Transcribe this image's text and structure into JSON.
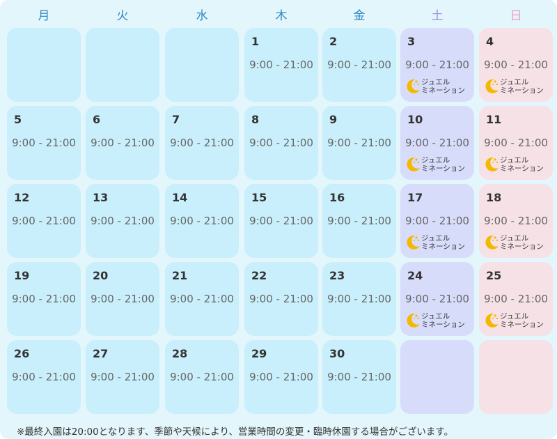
{
  "weekdays": [
    "月",
    "火",
    "水",
    "木",
    "金",
    "土",
    "日"
  ],
  "colors": {
    "page_bg": "#e3f6fb",
    "weekday_cell": "#c8effb",
    "saturday_cell": "#d7dcfb",
    "sunday_cell": "#f6e2e6",
    "weekday_header": "#2f86c6",
    "saturday_header": "#9f8fe0",
    "sunday_header": "#ee9cb8",
    "moon": "#f5b800"
  },
  "event": {
    "line1": "ジュエル",
    "line2": "ミネーション",
    "icon": "moon-icon"
  },
  "days": [
    {
      "d": "",
      "h": ""
    },
    {
      "d": "",
      "h": ""
    },
    {
      "d": "",
      "h": ""
    },
    {
      "d": "1",
      "h": "9:00 - 21:00"
    },
    {
      "d": "2",
      "h": "9:00 - 21:00"
    },
    {
      "d": "3",
      "h": "9:00 - 21:00",
      "ev": true
    },
    {
      "d": "4",
      "h": "9:00 - 21:00",
      "ev": true
    },
    {
      "d": "5",
      "h": "9:00 - 21:00"
    },
    {
      "d": "6",
      "h": "9:00 - 21:00"
    },
    {
      "d": "7",
      "h": "9:00 - 21:00"
    },
    {
      "d": "8",
      "h": "9:00 - 21:00"
    },
    {
      "d": "9",
      "h": "9:00 - 21:00"
    },
    {
      "d": "10",
      "h": "9:00 - 21:00",
      "ev": true
    },
    {
      "d": "11",
      "h": "9:00 - 21:00",
      "ev": true
    },
    {
      "d": "12",
      "h": "9:00 - 21:00"
    },
    {
      "d": "13",
      "h": "9:00 - 21:00"
    },
    {
      "d": "14",
      "h": "9:00 - 21:00"
    },
    {
      "d": "15",
      "h": "9:00 - 21:00"
    },
    {
      "d": "16",
      "h": "9:00 - 21:00"
    },
    {
      "d": "17",
      "h": "9:00 - 21:00",
      "ev": true
    },
    {
      "d": "18",
      "h": "9:00 - 21:00",
      "ev": true
    },
    {
      "d": "19",
      "h": "9:00 - 21:00"
    },
    {
      "d": "20",
      "h": "9:00 - 21:00"
    },
    {
      "d": "21",
      "h": "9:00 - 21:00"
    },
    {
      "d": "22",
      "h": "9:00 - 21:00"
    },
    {
      "d": "23",
      "h": "9:00 - 21:00"
    },
    {
      "d": "24",
      "h": "9:00 - 21:00",
      "ev": true
    },
    {
      "d": "25",
      "h": "9:00 - 21:00",
      "ev": true
    },
    {
      "d": "26",
      "h": "9:00 - 21:00"
    },
    {
      "d": "27",
      "h": "9:00 - 21:00"
    },
    {
      "d": "28",
      "h": "9:00 - 21:00"
    },
    {
      "d": "29",
      "h": "9:00 - 21:00"
    },
    {
      "d": "30",
      "h": "9:00 - 21:00"
    },
    {
      "d": "",
      "h": ""
    },
    {
      "d": "",
      "h": ""
    }
  ],
  "footnote": "※最終入園は20:00となります、季節や天候により、営業時間の変更・臨時休園する場合がございます。"
}
